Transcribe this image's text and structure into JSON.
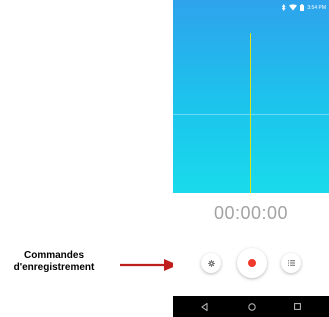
{
  "annotation": {
    "label_line1": "Commandes",
    "label_line2": "d'enregistrement",
    "arrow_color": "#c0201c"
  },
  "status_bar": {
    "time": "3:54 PM",
    "icons": [
      "bluetooth-icon",
      "wifi-icon",
      "battery-icon"
    ]
  },
  "recorder": {
    "timer": "00:00:00",
    "colors": {
      "gradient_top": "#2ea3ec",
      "gradient_bottom": "#19dbeb",
      "playhead": "#d9e21d",
      "record": "#f23a2c"
    },
    "controls": [
      {
        "name": "settings",
        "icon": "gear-icon"
      },
      {
        "name": "record",
        "icon": "record-dot-icon"
      },
      {
        "name": "recordings-list",
        "icon": "list-icon"
      }
    ]
  },
  "nav_bar": {
    "buttons": [
      "back-icon",
      "home-icon",
      "recents-icon"
    ]
  }
}
